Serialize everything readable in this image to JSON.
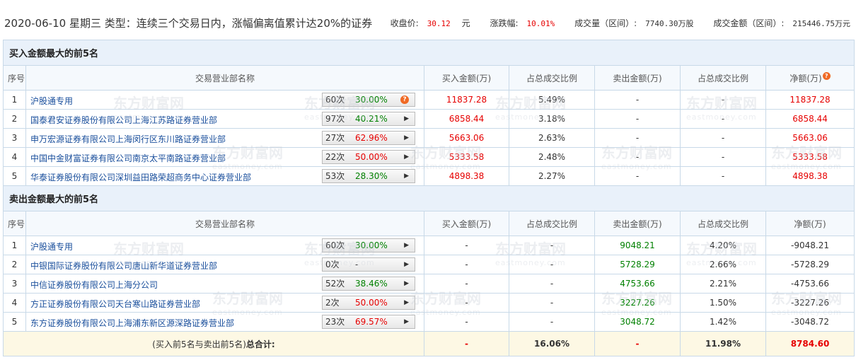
{
  "header": {
    "date": "2020-06-10",
    "weekday": "星期三",
    "type_label": "类型：",
    "type_value": "连续三个交易日内，涨幅偏离值累计达20%的证券",
    "close_label": "收盘价:",
    "close_value": "30.12",
    "close_unit": "元",
    "change_label": "涨跌幅:",
    "change_value": "10.01%",
    "volume_label": "成交量（区间）:",
    "volume_value": "7740.30万股",
    "amount_label": "成交金额（区间）:",
    "amount_value": "215446.75万元"
  },
  "columns": {
    "seq": "序号",
    "name": "交易营业部名称",
    "buy": "买入金额(万)",
    "buy_pct": "占总成交比例",
    "sell": "卖出金额(万)",
    "sell_pct": "占总成交比例",
    "net": "净额(万)"
  },
  "buy_section": {
    "title": "买入金额最大的前5名",
    "rows": [
      {
        "seq": "1",
        "name": "沪股通专用",
        "count": "60次",
        "rate": "30.00%",
        "buy": "11837.28",
        "buy_pct": "5.49%",
        "sell": "-",
        "sell_pct": "-",
        "net": "11837.28"
      },
      {
        "seq": "2",
        "name": "国泰君安证券股份有限公司上海江苏路证券营业部",
        "count": "97次",
        "rate": "40.21%",
        "buy": "6858.44",
        "buy_pct": "3.18%",
        "sell": "-",
        "sell_pct": "-",
        "net": "6858.44"
      },
      {
        "seq": "3",
        "name": "申万宏源证券有限公司上海闵行区东川路证券营业部",
        "count": "27次",
        "rate": "62.96%",
        "buy": "5663.06",
        "buy_pct": "2.63%",
        "sell": "-",
        "sell_pct": "-",
        "net": "5663.06"
      },
      {
        "seq": "4",
        "name": "中国中金财富证券有限公司南京太平南路证券营业部",
        "count": "22次",
        "rate": "50.00%",
        "buy": "5333.58",
        "buy_pct": "2.48%",
        "sell": "-",
        "sell_pct": "-",
        "net": "5333.58"
      },
      {
        "seq": "5",
        "name": "华泰证券股份有限公司深圳益田路荣超商务中心证券营业部",
        "count": "53次",
        "rate": "28.30%",
        "buy": "4898.38",
        "buy_pct": "2.27%",
        "sell": "-",
        "sell_pct": "-",
        "net": "4898.38"
      }
    ]
  },
  "sell_section": {
    "title": "卖出金额最大的前5名",
    "rows": [
      {
        "seq": "1",
        "name": "沪股通专用",
        "count": "60次",
        "rate": "30.00%",
        "buy": "-",
        "buy_pct": "-",
        "sell": "9048.21",
        "sell_pct": "4.20%",
        "net": "-9048.21"
      },
      {
        "seq": "2",
        "name": "中银国际证券股份有限公司唐山新华道证券营业部",
        "count": "0次",
        "rate": "-",
        "buy": "-",
        "buy_pct": "-",
        "sell": "5728.29",
        "sell_pct": "2.66%",
        "net": "-5728.29"
      },
      {
        "seq": "3",
        "name": "中信证券股份有限公司上海分公司",
        "count": "52次",
        "rate": "38.46%",
        "buy": "-",
        "buy_pct": "-",
        "sell": "4753.66",
        "sell_pct": "2.21%",
        "net": "-4753.66"
      },
      {
        "seq": "4",
        "name": "方正证券股份有限公司天台寒山路证券营业部",
        "count": "2次",
        "rate": "50.00%",
        "buy": "-",
        "buy_pct": "-",
        "sell": "3227.26",
        "sell_pct": "1.50%",
        "net": "-3227.26"
      },
      {
        "seq": "5",
        "name": "东方证券股份有限公司上海浦东新区源深路证券营业部",
        "count": "23次",
        "rate": "69.57%",
        "buy": "-",
        "buy_pct": "-",
        "sell": "3048.72",
        "sell_pct": "1.42%",
        "net": "-3048.72"
      }
    ]
  },
  "total": {
    "label_prefix": "(买入前5名与卖出前5名)",
    "label_bold": "总合计:",
    "buy": "-",
    "buy_pct": "16.06%",
    "sell": "-",
    "sell_pct": "11.98%",
    "net": "8784.60"
  },
  "watermark": {
    "cn": "东方财富网",
    "en": "eastmoney.com"
  },
  "colors": {
    "up": "#e60000",
    "down": "#008000",
    "link": "#1a4f9c",
    "header_bg": "#e9f1fa",
    "total_bg": "#fdf8e4"
  }
}
